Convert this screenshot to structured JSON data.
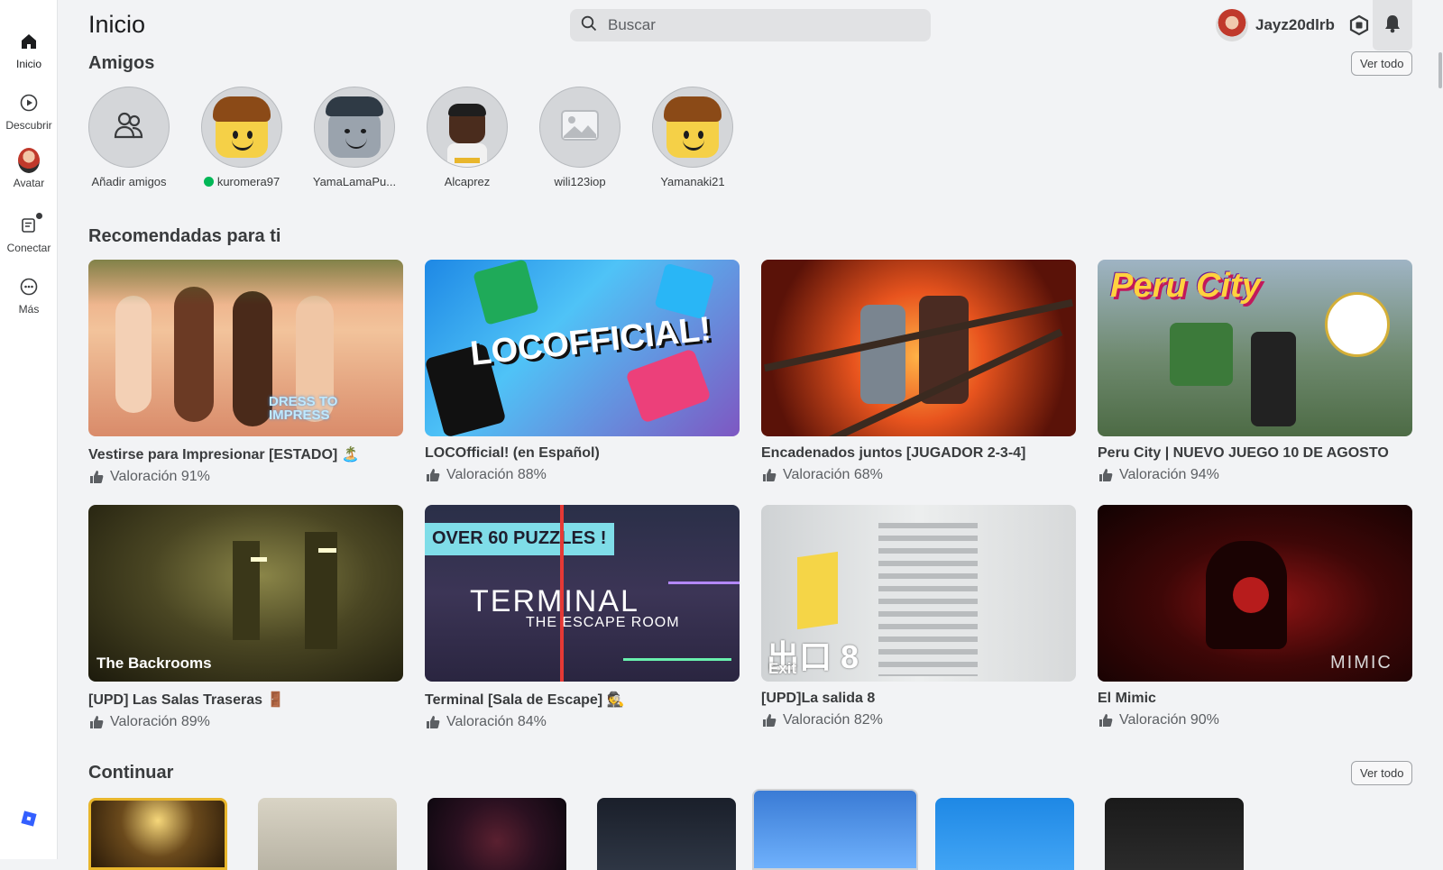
{
  "nav": {
    "items": [
      {
        "label": "Inicio",
        "icon": "home-icon"
      },
      {
        "label": "Descubrir",
        "icon": "play-circle-icon"
      },
      {
        "label": "Avatar",
        "icon": "avatar-icon"
      },
      {
        "label": "Conectar",
        "icon": "chat-icon"
      },
      {
        "label": "Más",
        "icon": "more-icon"
      }
    ]
  },
  "header": {
    "title": "Inicio",
    "search_placeholder": "Buscar",
    "username": "Jayz20dlrb"
  },
  "friends": {
    "title": "Amigos",
    "see_all": "Ver todo",
    "items": [
      {
        "name": "Añadir amigos",
        "online": false
      },
      {
        "name": "kuromera97",
        "online": true
      },
      {
        "name": "YamaLamaPu...",
        "online": false
      },
      {
        "name": "Alcaprez",
        "online": false
      },
      {
        "name": "wili123iop",
        "online": false
      },
      {
        "name": "Yamanaki21",
        "online": false
      }
    ]
  },
  "recommended": {
    "title": "Recomendadas para ti",
    "games": [
      {
        "title": "Vestirse para Impresionar [ESTADO] 🏝️",
        "rating": "Valoración 91%",
        "thumb_text": "DRESS TO IMPRESS"
      },
      {
        "title": "LOCOfficial! (en Español)",
        "rating": "Valoración 88%",
        "thumb_text": "LOCOFFICIAL!"
      },
      {
        "title": "Encadenados juntos [JUGADOR 2-3-4]",
        "rating": "Valoración 68%",
        "thumb_text": ""
      },
      {
        "title": "Peru City | NUEVO JUEGO 10 DE AGOSTO",
        "rating": "Valoración 94%",
        "thumb_text": "Peru City"
      },
      {
        "title": "[UPD] Las Salas Traseras 🚪",
        "rating": "Valoración 89%",
        "thumb_text": "The Backrooms"
      },
      {
        "title": "Terminal [Sala de Escape] 🕵️",
        "rating": "Valoración 84%",
        "thumb_text": "TERMINAL",
        "thumb_sub": "THE ESCAPE ROOM",
        "thumb_banner": "OVER 60 PUZZLES !"
      },
      {
        "title": "[UPD]La salida 8",
        "rating": "Valoración 82%",
        "thumb_text": "出口 8",
        "thumb_sub": "Exit"
      },
      {
        "title": "El Mimic",
        "rating": "Valoración 90%",
        "thumb_text": "MIMIC"
      }
    ]
  },
  "continue": {
    "title": "Continuar",
    "see_all": "Ver todo"
  },
  "colors": {
    "background": "#f2f3f5",
    "online": "#02b757"
  }
}
